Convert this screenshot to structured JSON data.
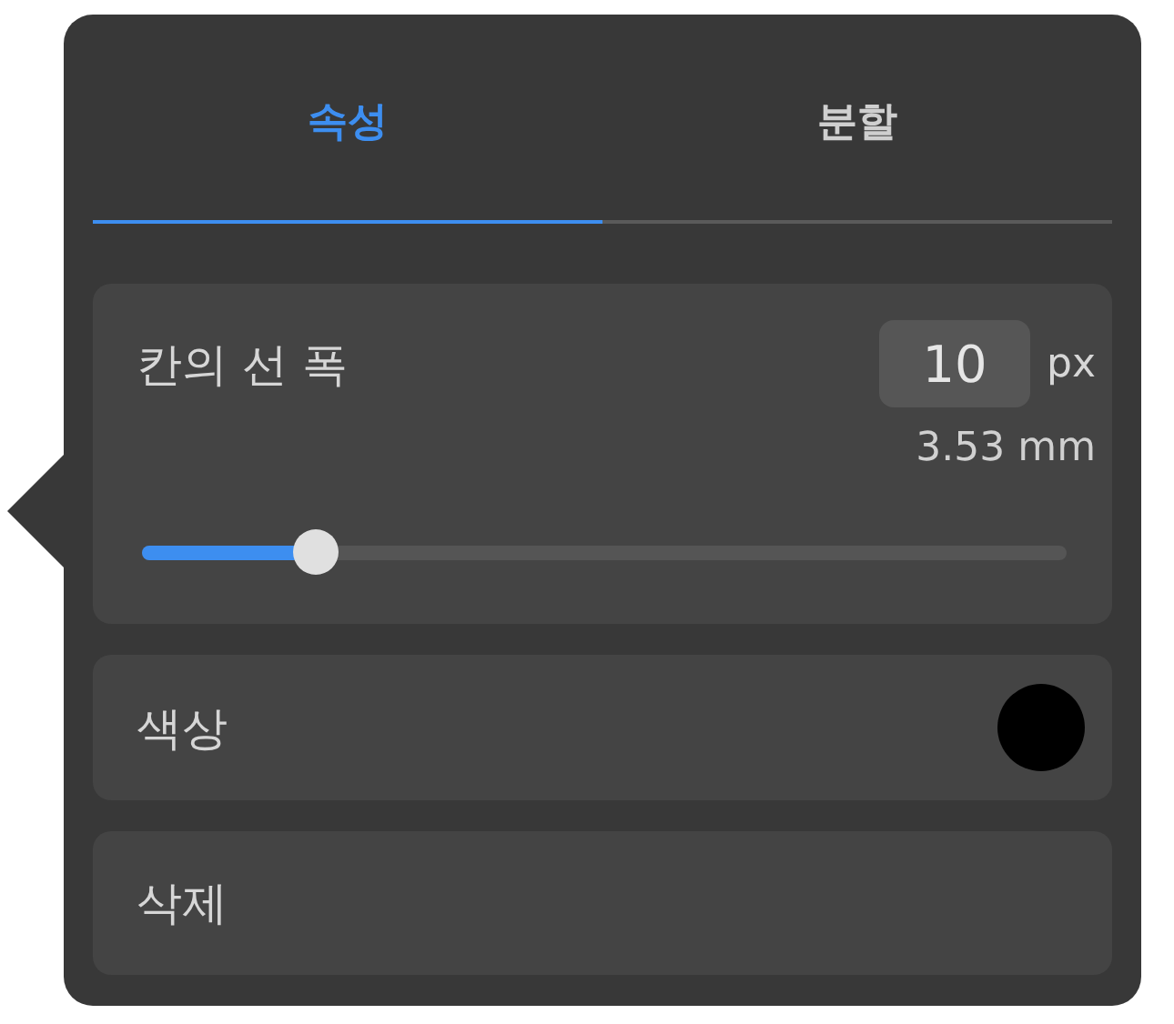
{
  "tabs": [
    {
      "label": "속성",
      "selected": true
    },
    {
      "label": "분할",
      "selected": false
    }
  ],
  "line_width": {
    "label": "칸의 선 폭",
    "value": "10",
    "unit": "px",
    "reading": "3.53 mm",
    "level": 0.187
  },
  "color": {
    "label": "색상",
    "color": "#000000"
  },
  "delete": {
    "label": "삭제"
  }
}
